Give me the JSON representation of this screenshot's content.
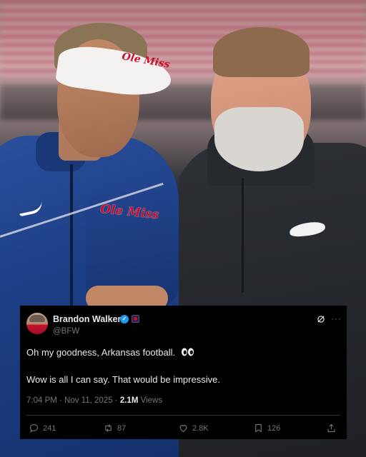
{
  "tweet": {
    "author_name": "Brandon Walker",
    "handle": "@BFW",
    "text_line1": "Oh my goodness, Arkansas football.",
    "text_line2": "Wow is all I can say. That would be impressive.",
    "time": "7:04 PM · Nov 11, 2025 · ",
    "views_count": "2.1M",
    "views_label": " Views",
    "replies": "241",
    "reposts": "87",
    "likes": "2.8K",
    "bookmarks": "126",
    "more_label": "···",
    "icons": [
      "verified-badge-icon",
      "affiliate-badge-icon",
      "grok-icon",
      "more-icon",
      "eyes-emoji-icon",
      "reply-icon",
      "repost-icon",
      "like-icon",
      "bookmark-icon",
      "share-icon"
    ],
    "colors": {
      "background": "#000000",
      "text": "#e7e9ea",
      "muted": "#71767b",
      "verified": "#1d9bf0"
    }
  },
  "photo": {
    "visor_text": "Ole Miss",
    "jacket_text": "Ole Miss"
  }
}
